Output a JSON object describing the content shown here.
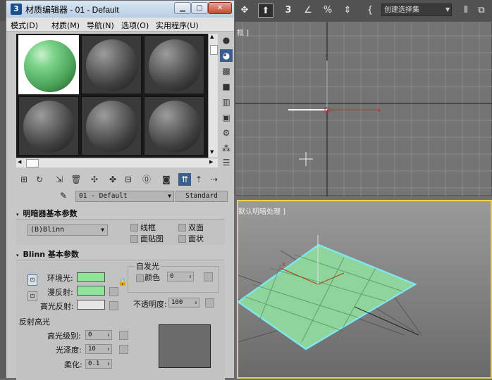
{
  "window": {
    "title": "材质编辑器 - 01 - Default",
    "app_icon": "3"
  },
  "menus": [
    "模式(D)",
    "材质(M)",
    "导航(N)",
    "选项(O)",
    "实用程序(U)"
  ],
  "slots": [
    {
      "selected": true,
      "color": "green"
    },
    {
      "selected": false,
      "color": "gray"
    },
    {
      "selected": false,
      "color": "gray"
    },
    {
      "selected": false,
      "color": "gray"
    },
    {
      "selected": false,
      "color": "gray"
    },
    {
      "selected": false,
      "color": "gray"
    }
  ],
  "material": {
    "name": "01 - Default",
    "type": "Standard"
  },
  "shader_rollout": {
    "title": "明暗器基本参数",
    "shader": "(B)Blinn",
    "options": [
      "线框",
      "双面",
      "面贴图",
      "面状"
    ]
  },
  "blinn_rollout": {
    "title": "Blinn 基本参数",
    "ambient_label": "环境光:",
    "diffuse_label": "漫反射:",
    "specular_label": "高光反射:",
    "ambient_color": "#90e498",
    "diffuse_color": "#90e498",
    "specular_color": "#e6e6e6",
    "self_illum_label": "自发光",
    "color_label": "颜色",
    "self_illum_value": "0",
    "opacity_label": "不透明度:",
    "opacity_value": "100",
    "specular_highlights_label": "反射高光",
    "specular_level_label": "高光级别:",
    "specular_level_value": "0",
    "glossiness_label": "光泽度:",
    "glossiness_value": "10",
    "soften_label": "柔化:",
    "soften_value": "0.1"
  },
  "viewports": {
    "top_label": "[ + ][顶][线框]",
    "top_label_visible": "框 ]",
    "persp_label": "默认明暗处理 ]",
    "toolbar_selection_set": "创建选择集"
  },
  "colors": {
    "plane_green": "#8fd49a",
    "plane_edge": "#7fe6ef",
    "active_viewport": "#e8d24a"
  }
}
